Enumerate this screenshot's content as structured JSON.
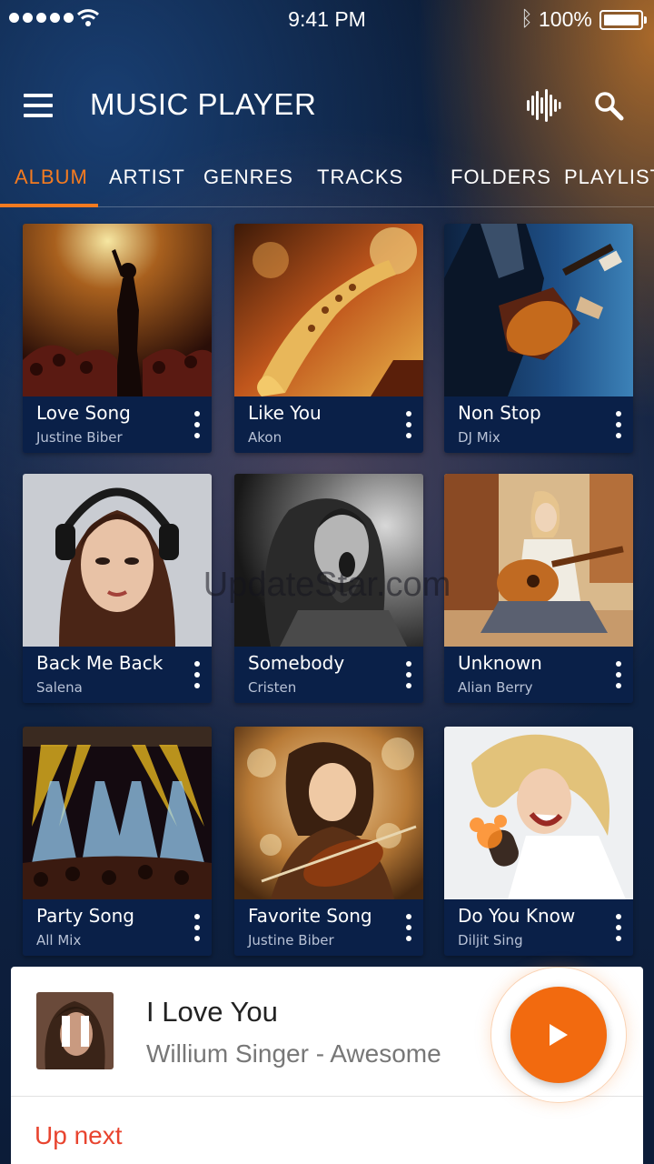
{
  "status_bar": {
    "time": "9:41 PM",
    "battery": "100%",
    "bluetooth_glyph": "ᛒ"
  },
  "header": {
    "title": "MUSIC PLAYER"
  },
  "tabs": [
    {
      "label": "ALBUM",
      "active": true
    },
    {
      "label": "ARTIST"
    },
    {
      "label": "GENRES"
    },
    {
      "label": "TRACKS"
    },
    {
      "label": "FOLDERS"
    },
    {
      "label": "PLAYLIST"
    }
  ],
  "albums": [
    {
      "title": "Love Song",
      "subtitle": "Justine Biber",
      "art": "concert-singer"
    },
    {
      "title": "Like You",
      "subtitle": "Akon",
      "art": "saxophone"
    },
    {
      "title": "Non Stop",
      "subtitle": "DJ Mix",
      "art": "guitarist"
    },
    {
      "title": "Back Me Back",
      "subtitle": "Salena",
      "art": "headphones-woman"
    },
    {
      "title": "Somebody",
      "subtitle": "Cristen",
      "art": "screaming-singer"
    },
    {
      "title": "Unknown",
      "subtitle": "Alian Berry",
      "art": "acoustic-guitar"
    },
    {
      "title": "Party Song",
      "subtitle": "All Mix",
      "art": "stage-lights"
    },
    {
      "title": "Favorite Song",
      "subtitle": "Justine Biber",
      "art": "violinist"
    },
    {
      "title": "Do You Know",
      "subtitle": "Diljit Sing",
      "art": "microphone-singer"
    }
  ],
  "watermark": "UpdateStar.com",
  "now_playing": {
    "title": "I Love You",
    "artist": "Willium Singer - Awesome",
    "up_next_label": "Up next",
    "state": "paused"
  },
  "colors": {
    "accent": "#f47b20",
    "play_button": "#f26a0f",
    "up_next": "#e8442f",
    "caption_bg": "#0a2048"
  }
}
